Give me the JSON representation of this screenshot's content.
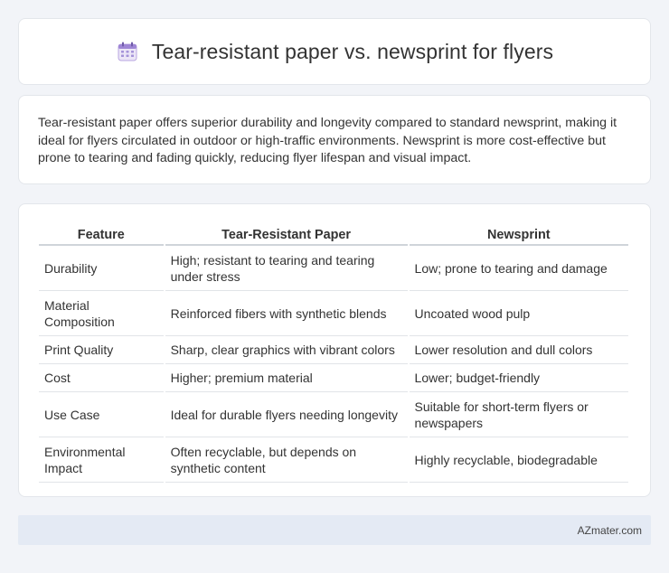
{
  "header": {
    "icon": "calendar-icon",
    "title": "Tear-resistant paper vs. newsprint for flyers"
  },
  "summary": {
    "text": "Tear-resistant paper offers superior durability and longevity compared to standard newsprint, making it ideal for flyers circulated in outdoor or high-traffic environments. Newsprint is more cost-effective but prone to tearing and fading quickly, reducing flyer lifespan and visual impact."
  },
  "table": {
    "headers": [
      "Feature",
      "Tear-Resistant Paper",
      "Newsprint"
    ],
    "rows": [
      [
        "Durability",
        "High; resistant to tearing and tearing under stress",
        "Low; prone to tearing and damage"
      ],
      [
        "Material Composition",
        "Reinforced fibers with synthetic blends",
        "Uncoated wood pulp"
      ],
      [
        "Print Quality",
        "Sharp, clear graphics with vibrant colors",
        "Lower resolution and dull colors"
      ],
      [
        "Cost",
        "Higher; premium material",
        "Lower; budget-friendly"
      ],
      [
        "Use Case",
        "Ideal for durable flyers needing longevity",
        "Suitable for short-term flyers or newspapers"
      ],
      [
        "Environmental Impact",
        "Often recyclable, but depends on synthetic content",
        "Highly recyclable, biodegradable"
      ]
    ]
  },
  "footer": {
    "brand": "AZmater.com"
  }
}
